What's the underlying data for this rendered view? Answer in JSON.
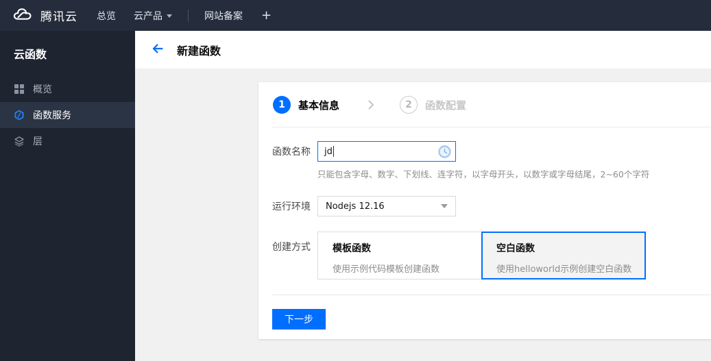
{
  "topbar": {
    "brand": "腾讯云",
    "nav_overview": "总览",
    "nav_products": "云产品",
    "nav_beian": "网站备案",
    "nav_plus": "+"
  },
  "sidebar": {
    "title": "云函数",
    "items": [
      {
        "label": "概览",
        "icon": "grid-icon",
        "active": false
      },
      {
        "label": "函数服务",
        "icon": "scf-icon",
        "active": true
      },
      {
        "label": "层",
        "icon": "layers-icon",
        "active": false
      }
    ]
  },
  "header": {
    "title": "新建函数"
  },
  "wizard": {
    "step1_number": "1",
    "step1_label": "基本信息",
    "step2_number": "2",
    "step2_label": "函数配置"
  },
  "form": {
    "name_label": "函数名称",
    "name_value": "jd",
    "name_hint": "只能包含字母、数字、下划线、连字符，以字母开头，以数字或字母结尾，2~60个字符",
    "runtime_label": "运行环境",
    "runtime_value": "Nodejs 12.16",
    "method_label": "创建方式",
    "method_options": [
      {
        "title": "模板函数",
        "desc": "使用示例代码模板创建函数",
        "selected": false
      },
      {
        "title": "空白函数",
        "desc": "使用helloworld示例创建空白函数",
        "selected": true
      }
    ],
    "next_button": "下一步"
  },
  "colors": {
    "accent": "#006eff",
    "topbar_bg": "#252d3c",
    "sidebar_bg": "#1e2430",
    "sidebar_active_bg": "#2b3444",
    "content_bg": "#f1f1f2"
  }
}
